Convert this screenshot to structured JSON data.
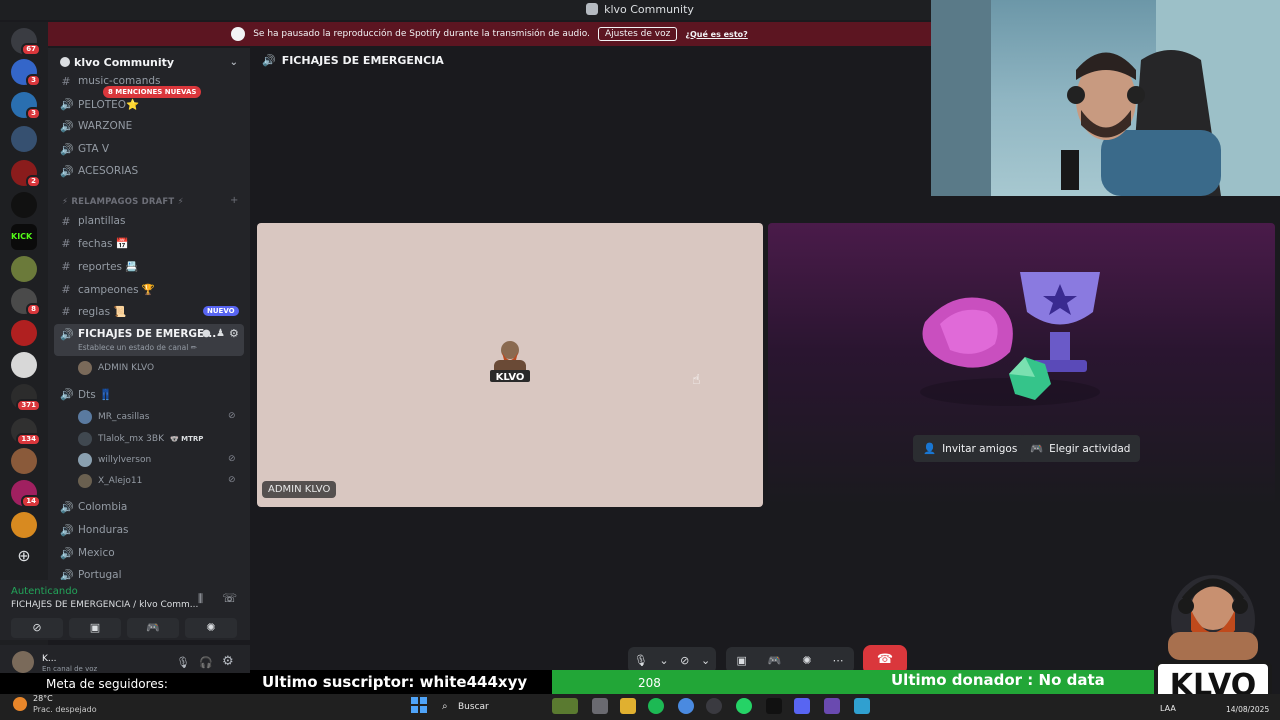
{
  "window": {
    "title": "klvo Community"
  },
  "spotify_notice": {
    "message": "Se ha pausado la reproducción de Spotify durante la transmisión de audio.",
    "settings_button": "Ajustes de voz",
    "info_link": "¿Qué es esto?"
  },
  "servers": [
    {
      "badge": "67"
    },
    {
      "badge": "3"
    },
    {
      "badge": "3"
    },
    {
      "badge": ""
    },
    {
      "badge": "2"
    },
    {
      "badge": ""
    },
    {
      "badge": ""
    },
    {
      "badge": ""
    },
    {
      "badge": "8"
    },
    {
      "badge": ""
    },
    {
      "badge": ""
    },
    {
      "badge": "371"
    },
    {
      "badge": "134"
    },
    {
      "badge": ""
    },
    {
      "badge": "14"
    },
    {
      "badge": ""
    }
  ],
  "guild": {
    "name": "klvo Community"
  },
  "mention_pill": "8 MENCIONES NUEVAS",
  "channels_top": [
    {
      "name": "music-comands",
      "type": "text"
    },
    {
      "name": "PELOTEO⭐",
      "type": "voice"
    },
    {
      "name": "WARZONE",
      "type": "voice"
    },
    {
      "name": "GTA V",
      "type": "voice"
    },
    {
      "name": "ACESORIAS",
      "type": "voice"
    }
  ],
  "category": "⚡ RELAMPAGOS DRAFT ⚡",
  "channels_text": [
    {
      "name": "plantillas"
    },
    {
      "name": "fechas 📅"
    },
    {
      "name": "reportes 📇"
    },
    {
      "name": "campeones 🏆"
    },
    {
      "name": "reglas 📜"
    }
  ],
  "new_badge": "NUEVO",
  "active_channel": {
    "name": "FICHAJES DE EMERGE...",
    "status": "Establece un estado de canal ✏"
  },
  "active_members": [
    {
      "name": "ADMIN KLVO"
    }
  ],
  "dts_channel": {
    "name": "Dts 👖"
  },
  "dts_members": [
    {
      "name": "MR_casillas"
    },
    {
      "name": "Tlalok_mx 3BK",
      "tag": "🐨 MTRP"
    },
    {
      "name": "willylverson"
    },
    {
      "name": "X_Alejo11"
    }
  ],
  "channels_bottom": [
    {
      "name": "Colombia"
    },
    {
      "name": "Honduras"
    },
    {
      "name": "Mexico"
    },
    {
      "name": "Portugal"
    }
  ],
  "voice_connection": {
    "status": "Autenticando",
    "channel": "FICHAJES DE EMERGENCIA / klvo Comm..."
  },
  "user_panel": {
    "name": "K...",
    "status": "En canal de voz"
  },
  "main": {
    "channel_title": "FICHAJES DE EMERGENCIA",
    "tile_label": "ADMIN KLVO",
    "avatar_text": "KLVO",
    "invite_button": "Invitar amigos",
    "activity_button": "Elegir actividad"
  },
  "stream_overlay": {
    "followers": "Meta de seguidores:",
    "subscriber": "Ultimo suscriptor: white444xyy",
    "follower_count": "208",
    "donor": "Ultimo donador : No data",
    "logo_text": "KLVO"
  },
  "taskbar": {
    "temp": "28°C",
    "weather": "Prac. despejado",
    "search": "Buscar",
    "lang": "LAA",
    "date": "14/08/2025"
  },
  "colors": {
    "accent": "#5865f2",
    "danger": "#da373c",
    "success": "#23a55a",
    "overlay_green": "#22a637"
  }
}
